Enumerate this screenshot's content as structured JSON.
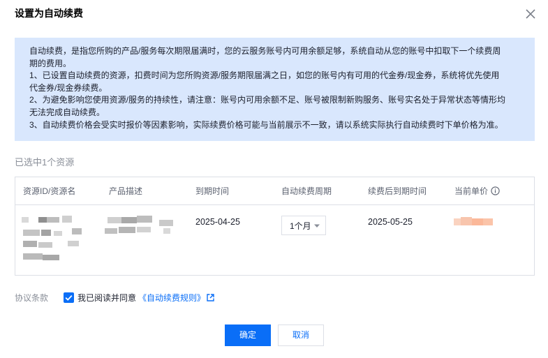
{
  "dialog": {
    "title": "设置为自动续费",
    "close_icon": "close-icon"
  },
  "notice": {
    "lines": [
      "自动续费，是指您所购的产品/服务每次期限届满时，您的云服务账号内可用余额足够，系统自动从您的账号中扣取下一个续费周",
      "期的费用。",
      "1、已设置自动续费的资源，扣费时间为您所购资源/服务期限届满之日，如您的账号内有可用的代金券/现金券，系统将优先使用",
      "代金券/现金券续费。",
      "2、为避免影响您使用资源/服务的持续性，请注意：账号内可用余额不足、账号被限制新购服务、账号实名处于异常状态等情形均",
      "无法完成自动续费。",
      "3、自动续费价格会受实时报价等因素影响，实际续费价格可能与当前展示不一致，请以系统实际执行自动续费时下单价格为准。"
    ]
  },
  "selection": {
    "label": "已选中1个资源"
  },
  "table": {
    "headers": {
      "resource": "资源ID/资源名",
      "product": "产品描述",
      "expiry": "到期时间",
      "period": "自动续费周期",
      "new_expiry": "续费后到期时间",
      "price": "当前单价"
    },
    "row": {
      "expiry": "2025-04-25",
      "period": "1个月",
      "new_expiry": "2025-05-25"
    }
  },
  "agreement": {
    "label": "协议条款",
    "checked": true,
    "text": "我已阅读并同意",
    "link": "《自动续费规则》"
  },
  "buttons": {
    "confirm": "确定",
    "cancel": "取消"
  },
  "colors": {
    "primary": "#0a6ef7",
    "notice_bg": "#d9e7fd",
    "border": "#dcdfe6",
    "muted_text": "#8a8f99"
  }
}
